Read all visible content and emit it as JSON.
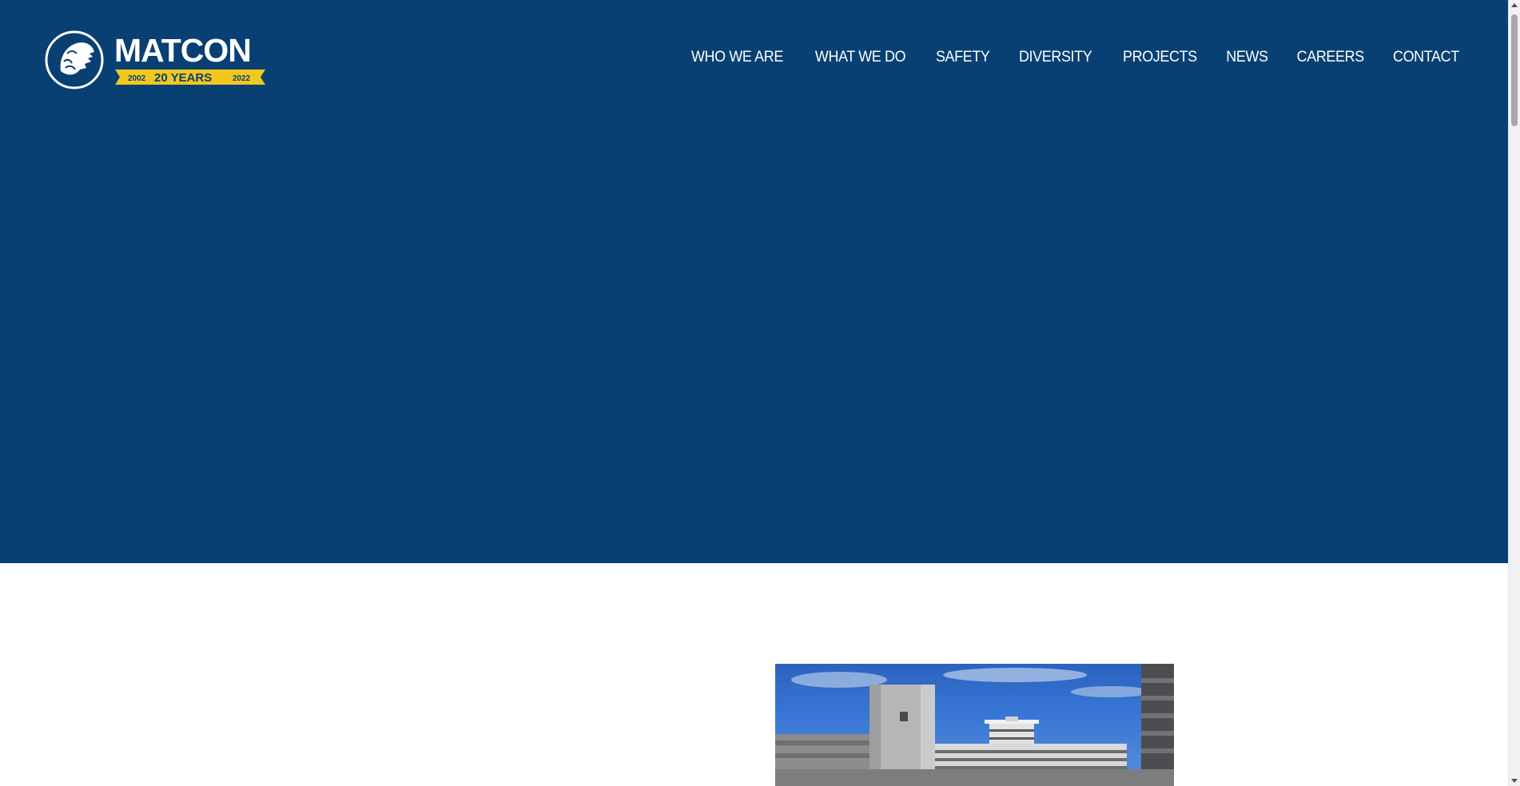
{
  "brand": {
    "name": "MATCON",
    "anniversary_start": "2002",
    "anniversary_label": "20 YEARS",
    "anniversary_end": "2022",
    "primary_color": "#084073",
    "accent_color": "#f2c81f",
    "logo_icon": "lion-head-icon"
  },
  "nav": {
    "items": [
      {
        "label": "WHO WE ARE"
      },
      {
        "label": "WHAT WE DO"
      },
      {
        "label": "SAFETY"
      },
      {
        "label": "DIVERSITY"
      },
      {
        "label": "PROJECTS"
      },
      {
        "label": "NEWS"
      },
      {
        "label": "CAREERS"
      },
      {
        "label": "CONTACT"
      }
    ]
  },
  "content": {
    "image_subject": "airport-terminal-building-photo"
  }
}
